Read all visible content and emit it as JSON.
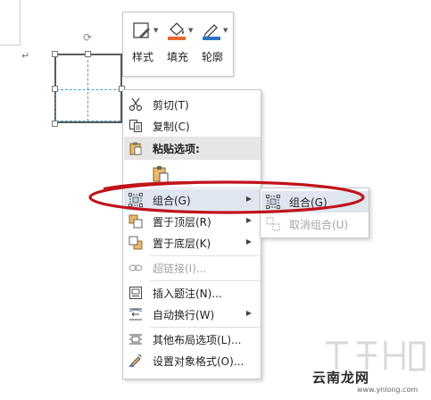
{
  "document": {
    "paragraph_mark": "↵"
  },
  "mini_toolbar": {
    "buttons": [
      {
        "label": "样式",
        "icon": "shape-style-icon"
      },
      {
        "label": "填充",
        "icon": "fill-bucket-icon"
      },
      {
        "label": "轮廓",
        "icon": "outline-pen-icon"
      }
    ],
    "fill_color": "#e8692c",
    "outline_color": "#2e75c8"
  },
  "context_menu": {
    "cut": "剪切(T)",
    "copy": "复制(C)",
    "paste_options": "粘贴选项:",
    "group": "组合(G)",
    "bring_to_front": "置于顶层(R)",
    "send_to_back": "置于底层(K)",
    "hyperlink": "超链接(I)...",
    "insert_caption": "插入题注(N)...",
    "wrap_text": "自动换行(W)",
    "more_layout": "其他布局选项(L)...",
    "format_object": "设置对象格式(O)..."
  },
  "group_submenu": {
    "group": "组合(G)",
    "ungroup": "取消组合(U)"
  },
  "annotation": {
    "ellipse_color": "#c0141b"
  },
  "watermark": {
    "text": "云南龙网",
    "url": "www.ynlong.com"
  }
}
